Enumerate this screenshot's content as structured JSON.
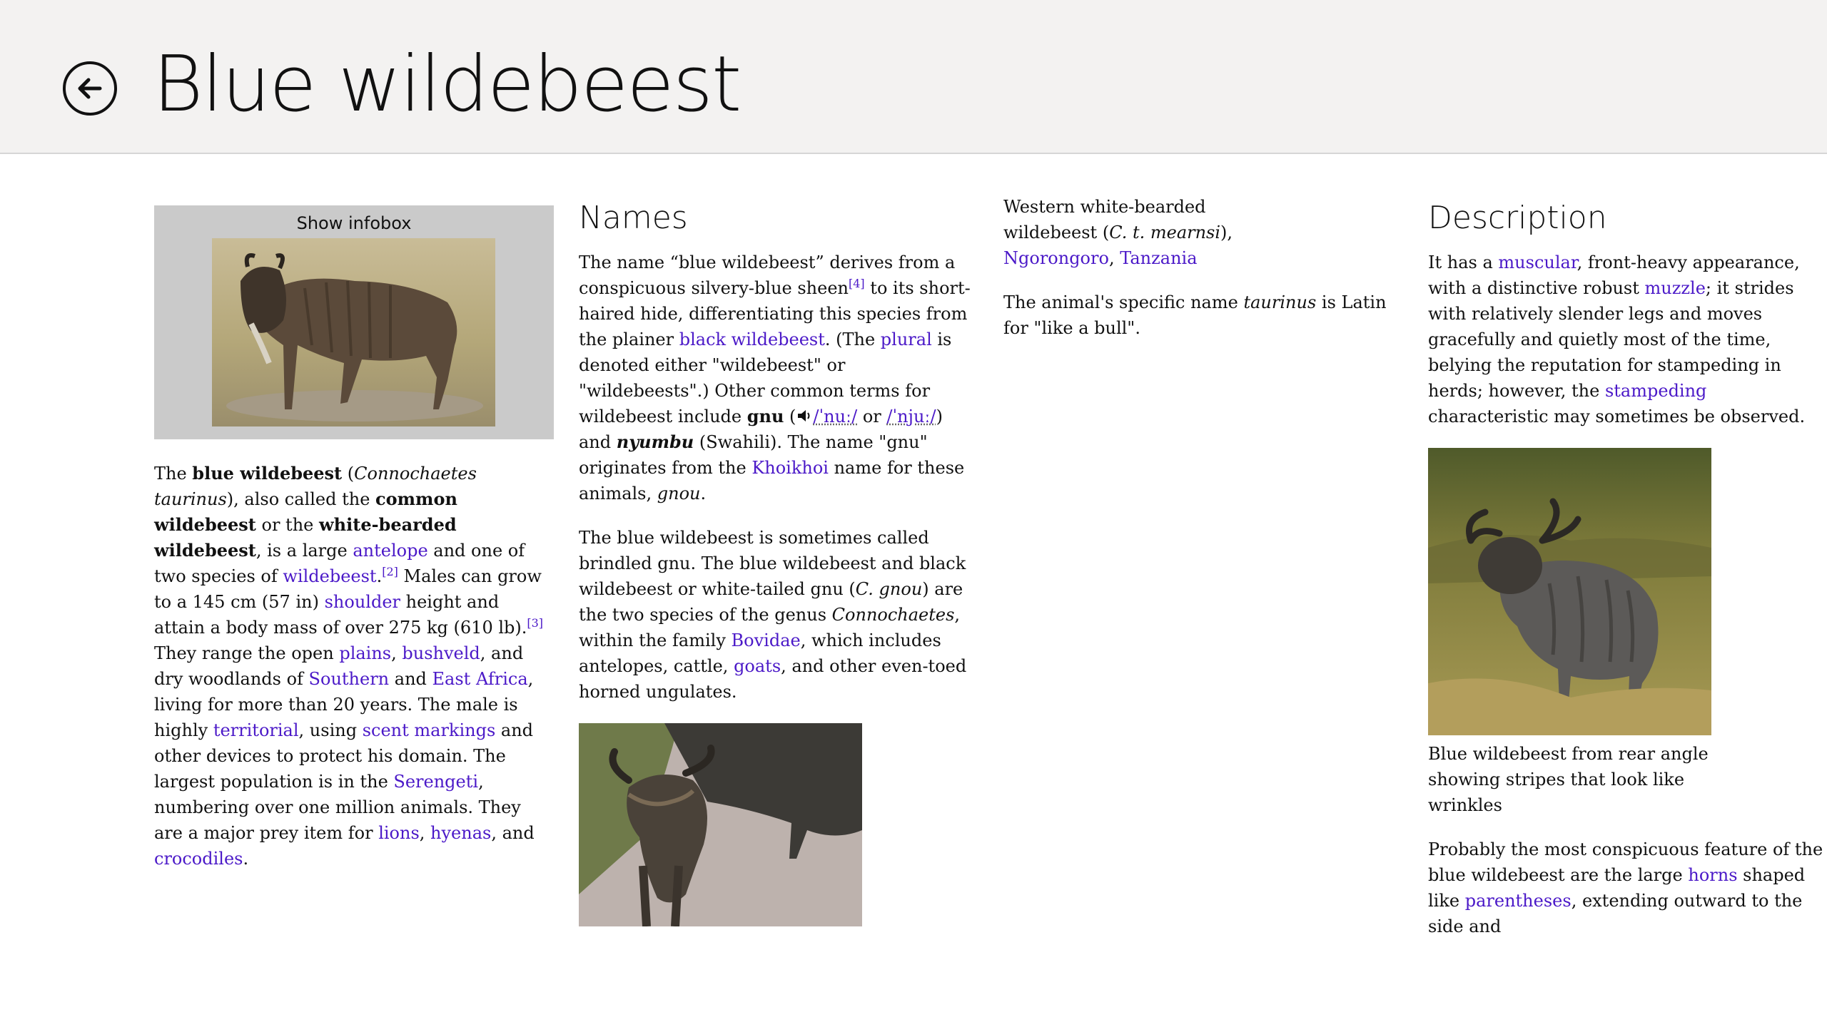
{
  "header": {
    "title": "Blue wildebeest"
  },
  "infobox": {
    "label": "Show infobox"
  },
  "intro": {
    "p1": "The ",
    "b1": "blue wildebeest",
    "p2": " (",
    "i1": "Connochaetes taurinus",
    "p3": "), also called the ",
    "b2": "common wildebeest",
    "p4": " or the ",
    "b3": "white-bearded wildebeest",
    "p5": ", is a large ",
    "l_antelope": "antelope",
    "p6": " and one of two species of ",
    "l_wildebeest": "wildebeest",
    "p7": ".",
    "ref2": "[2]",
    "p8": " Males can grow to a 145 cm (57 in) ",
    "l_shoulder": "shoulder",
    "p9": " height and attain a body mass of over 275 kg (610 lb).",
    "ref3": "[3]",
    "p10": " They range the open ",
    "l_plains": "plains",
    "p11": ", ",
    "l_bushveld": "bushveld",
    "p12": ", and dry woodlands of ",
    "l_southern": "Southern",
    "p13": " and ",
    "l_eastafrica": "East Africa",
    "p14": ", living for more than 20 years. The male is highly ",
    "l_territorial": "territorial",
    "p15": ", using ",
    "l_scent": "scent markings",
    "p16": " and other devices to protect his domain. The largest population is in the ",
    "l_serengeti": "Serengeti",
    "p17": ", numbering over one million animals. They are a major prey item for ",
    "l_lions": "lions",
    "p18": ", ",
    "l_hyenas": "hyenas",
    "p19": ", and ",
    "l_crocodiles": "crocodiles",
    "p20": "."
  },
  "names": {
    "heading": "Names",
    "a1": "The name “blue wildebeest” derives from a conspicuous silvery-blue sheen",
    "ref4": "[4]",
    "a2": " to its short-haired hide, differentiating this species from the plainer ",
    "l_black": "black wildebeest",
    "a3": ". (The ",
    "l_plural": "plural",
    "a4": " is denoted either \"wildebeest\" or \"wildebeests\".) Other common terms for wildebeest include ",
    "b_gnu": "gnu",
    "a5": " (",
    "ipa1": "/ˈnuː/",
    "a6": " or ",
    "ipa2": "/ˈnjuː/",
    "a7": ") and ",
    "b_nyumbu": "nyumbu",
    "a8": " (Swahili). The name \"gnu\" originates from the ",
    "l_khoikhoi": "Khoikhoi",
    "a9": " name for these animals, ",
    "i_gnou": "gnou",
    "a10": ".",
    "c1": "The blue wildebeest is sometimes called brindled gnu. The blue wildebeest and black wildebeest or white-tailed gnu (",
    "i_cgnou": "C. gnou",
    "c2": ") are the two species of the genus ",
    "i_conn": "Connochaetes",
    "c3": ", within the family ",
    "l_bovidae": "Bovidae",
    "c4": ", which includes antelopes, cattle, ",
    "l_goats": "goats",
    "c5": ", and other even-toed horned ungulates."
  },
  "col3": {
    "d1": "Western white-bearded wildebeest (",
    "i_ctm": "C. t. mearnsi",
    "d2": "), ",
    "l_ngorongoro": "Ngorongoro",
    "d3": ", ",
    "l_tanzania": "Tanzania",
    "e1": "The animal's specific name ",
    "i_taurinus": "taurinus",
    "e2": " is Latin for \"like a bull\"."
  },
  "description": {
    "heading": "Description",
    "f1": "It has a ",
    "l_muscular": "muscular",
    "f2": ", front-heavy appearance, with a distinctive robust ",
    "l_muzzle": "muzzle",
    "f3": "; it strides with relatively slender legs and moves gracefully and quietly most of the time, belying the reputation for stampeding in herds; however, the ",
    "l_stampeding": "stampeding",
    "f4": " characteristic may sometimes be observed.",
    "caption": "Blue wildebeest from rear angle showing stripes that look like wrinkles",
    "g1": "Probably the most conspicuous feature of the blue wildebeest are the large ",
    "l_horns": "horns",
    "g2": " shaped like ",
    "l_parentheses": "parentheses",
    "g3": ", extending outward to the side and"
  }
}
